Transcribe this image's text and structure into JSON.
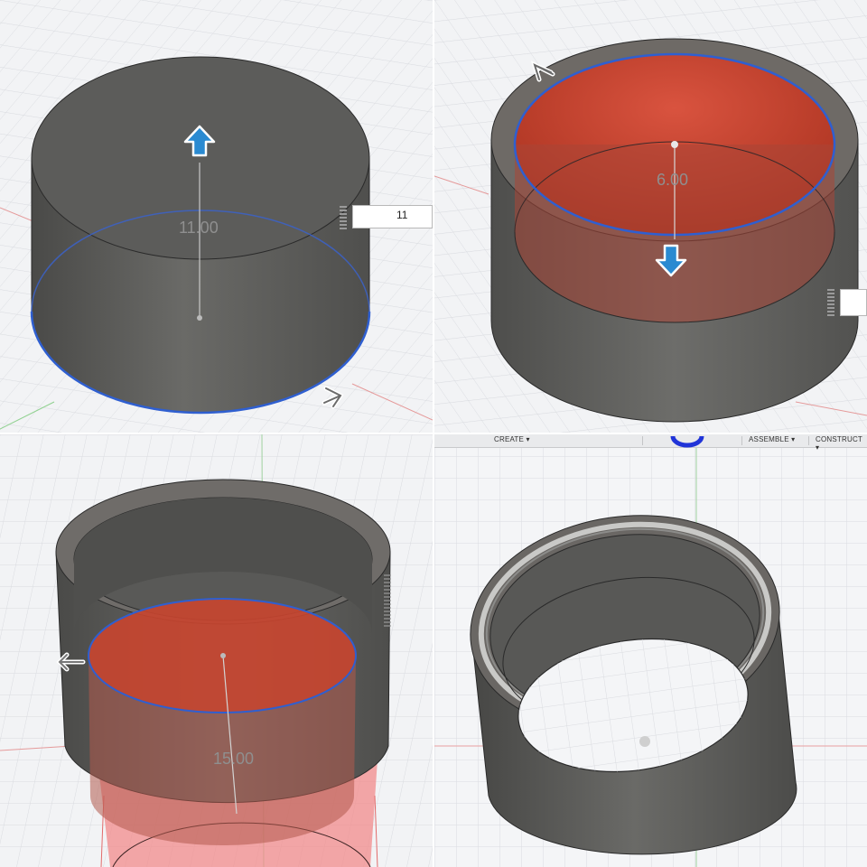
{
  "panels": [
    {
      "dimension": "11.00",
      "input_value": "11"
    },
    {
      "dimension": "6.00",
      "input_value": ""
    },
    {
      "dimension": "15.00"
    },
    {}
  ],
  "toolbar": {
    "items": [
      "CREATE ▾",
      "ASSEMBLE ▾",
      "CONSTRUCT ▾"
    ]
  },
  "colors": {
    "body": "#5f5f5c",
    "cut_fill": "#c8412f",
    "selection_edge": "#2f5fd0",
    "grid": "#d6d8dc",
    "manipulator_arrow": "#2a8ad1"
  },
  "icons": [
    "up-arrow-icon",
    "down-arrow-icon",
    "drag-arrow-icon",
    "grip-icon"
  ]
}
